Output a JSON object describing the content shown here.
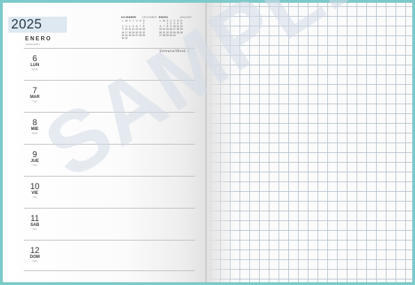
{
  "year": "2025",
  "month_es": "ENERO",
  "month_en": "JANUARY",
  "week_label": "Semana/Week 2",
  "mini_calendars": [
    {
      "title": "DICIEMBRE",
      "subtitle": "DECEMBER",
      "weekday_initials": [
        "L",
        "M",
        "X",
        "J",
        "V",
        "S",
        "D"
      ],
      "cells": [
        "",
        "",
        "",
        "",
        "",
        "",
        "1",
        "2",
        "3",
        "4",
        "5",
        "6",
        "7",
        "8",
        "9",
        "10",
        "11",
        "12",
        "13",
        "14",
        "15",
        "16",
        "17",
        "18",
        "19",
        "20",
        "21",
        "22",
        "23",
        "24",
        "25",
        "26",
        "27",
        "28",
        "29",
        "30",
        "31",
        "",
        "",
        "",
        "",
        ""
      ]
    },
    {
      "title": "ENERO",
      "subtitle": "JANUARY",
      "weekday_initials": [
        "L",
        "M",
        "X",
        "J",
        "V",
        "S",
        "D"
      ],
      "cells": [
        "",
        "",
        "1",
        "2",
        "3",
        "4",
        "5",
        "6",
        "7",
        "8",
        "9",
        "10",
        "11",
        "12",
        "13",
        "14",
        "15",
        "16",
        "17",
        "18",
        "19",
        "20",
        "21",
        "22",
        "23",
        "24",
        "25",
        "26",
        "27",
        "28",
        "29",
        "30",
        "31",
        "",
        "",
        ""
      ]
    }
  ],
  "days": [
    {
      "num": "6",
      "es": "LUN",
      "en": "MON"
    },
    {
      "num": "7",
      "es": "MAR",
      "en": "TUE"
    },
    {
      "num": "8",
      "es": "MIE",
      "en": "WED"
    },
    {
      "num": "9",
      "es": "JUE",
      "en": "THU"
    },
    {
      "num": "10",
      "es": "VIE",
      "en": "FRI"
    },
    {
      "num": "11",
      "es": "SAB",
      "en": "SAT"
    },
    {
      "num": "12",
      "es": "DOM",
      "en": "SUN"
    }
  ],
  "watermark": "SAMPLE",
  "colors": {
    "cover": "#7ec9c9",
    "grid": "#b7c3cf",
    "year_box": "#dde8f0"
  }
}
